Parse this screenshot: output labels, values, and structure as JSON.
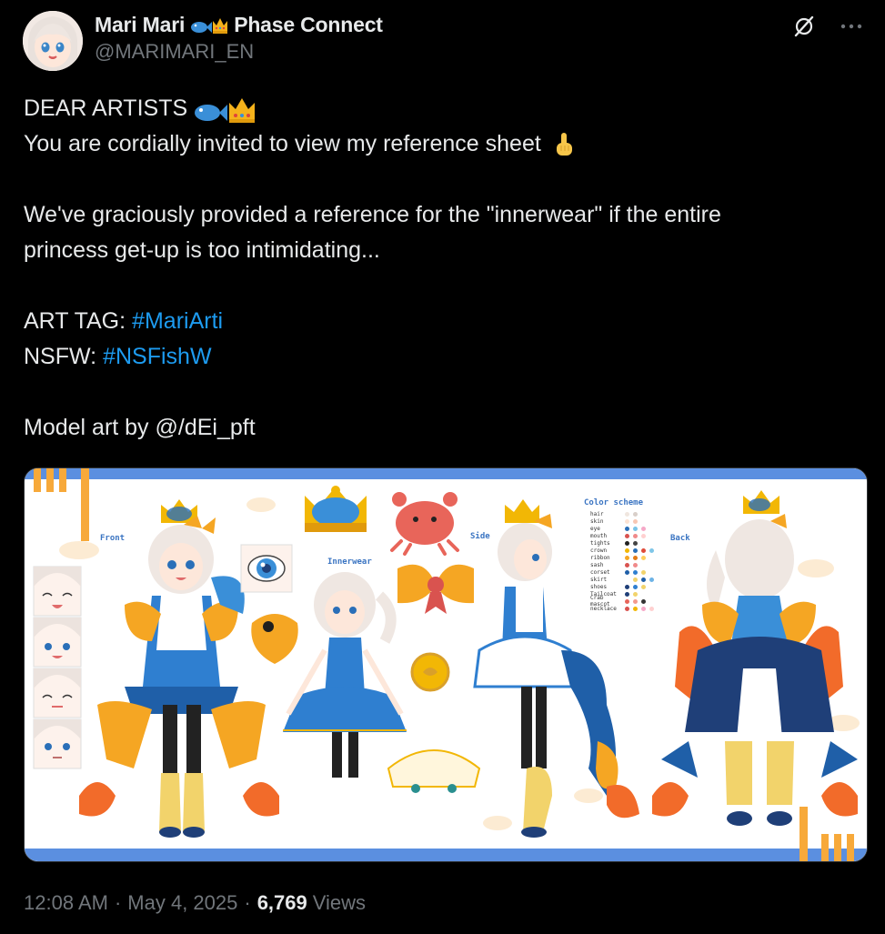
{
  "author": {
    "display_name": "Mari Mari",
    "org_name": "Phase Connect",
    "handle": "@MARIMARI_EN"
  },
  "tweet": {
    "line1": "DEAR ARTISTS",
    "line2": "You are cordially invited to view my reference sheet",
    "line3": "We've graciously provided a reference for the \"innerwear\" if the entire",
    "line4": "princess get-up is too intimidating...",
    "art_tag_label": "ART TAG:",
    "art_tag": "#MariArti",
    "nsfw_label": "NSFW:",
    "nsfw_tag": "#NSFishW",
    "credit": "Model art by @/dEi_pft"
  },
  "media": {
    "label_front": "Front",
    "label_innerwear": "Innerwear",
    "label_side": "Side",
    "label_back": "Back",
    "color_scheme_title": "Color scheme",
    "palette": [
      {
        "name": "hair",
        "colors": [
          "#f0e6df",
          "#d9cfc9"
        ]
      },
      {
        "name": "skin",
        "colors": [
          "#fde3d3",
          "#f7c7b3"
        ]
      },
      {
        "name": "eye",
        "colors": [
          "#2a6fb8",
          "#79c5e8",
          "#f6a8c8"
        ]
      },
      {
        "name": "mouth",
        "colors": [
          "#d9534f",
          "#f08a8a",
          "#ffd0d0"
        ]
      },
      {
        "name": "tights",
        "colors": [
          "#222222",
          "#444444"
        ]
      },
      {
        "name": "crown",
        "colors": [
          "#f2b705",
          "#2a6fb8",
          "#e04b3a",
          "#7fc6e8"
        ]
      },
      {
        "name": "ribbon",
        "colors": [
          "#f5a623",
          "#e37b17",
          "#ffcf5c"
        ]
      },
      {
        "name": "sash",
        "colors": [
          "#d9534f",
          "#f08a8a"
        ]
      },
      {
        "name": "corset",
        "colors": [
          "#1f5fa8",
          "#2f7fd0",
          "#f2d36b"
        ]
      },
      {
        "name": "skirt",
        "colors": [
          "#ffffff",
          "#f2d36b",
          "#1f5fa8",
          "#6db3e6"
        ]
      },
      {
        "name": "shoes",
        "colors": [
          "#1f3f78",
          "#2f7fd0",
          "#f2d36b"
        ]
      },
      {
        "name": "Tailcoat",
        "colors": [
          "#1f3f78",
          "#f2d36b",
          "#ffffff"
        ]
      },
      {
        "name": "Crab mascot",
        "colors": [
          "#e8655a",
          "#f49a8c",
          "#333333"
        ]
      },
      {
        "name": "necklace",
        "colors": [
          "#d9534f",
          "#f2b705",
          "#f6a8c8",
          "#ffd0d0"
        ]
      }
    ]
  },
  "meta": {
    "time": "12:08 AM",
    "date": "May 4, 2025",
    "views_count": "6,769",
    "views_label": "Views"
  },
  "colors": {
    "background": "#000000",
    "text": "#e7e9ea",
    "secondary": "#71767b",
    "link": "#1d9bf0",
    "media_accent": "#5b8fe0",
    "media_stripe": "#f7a93a"
  }
}
